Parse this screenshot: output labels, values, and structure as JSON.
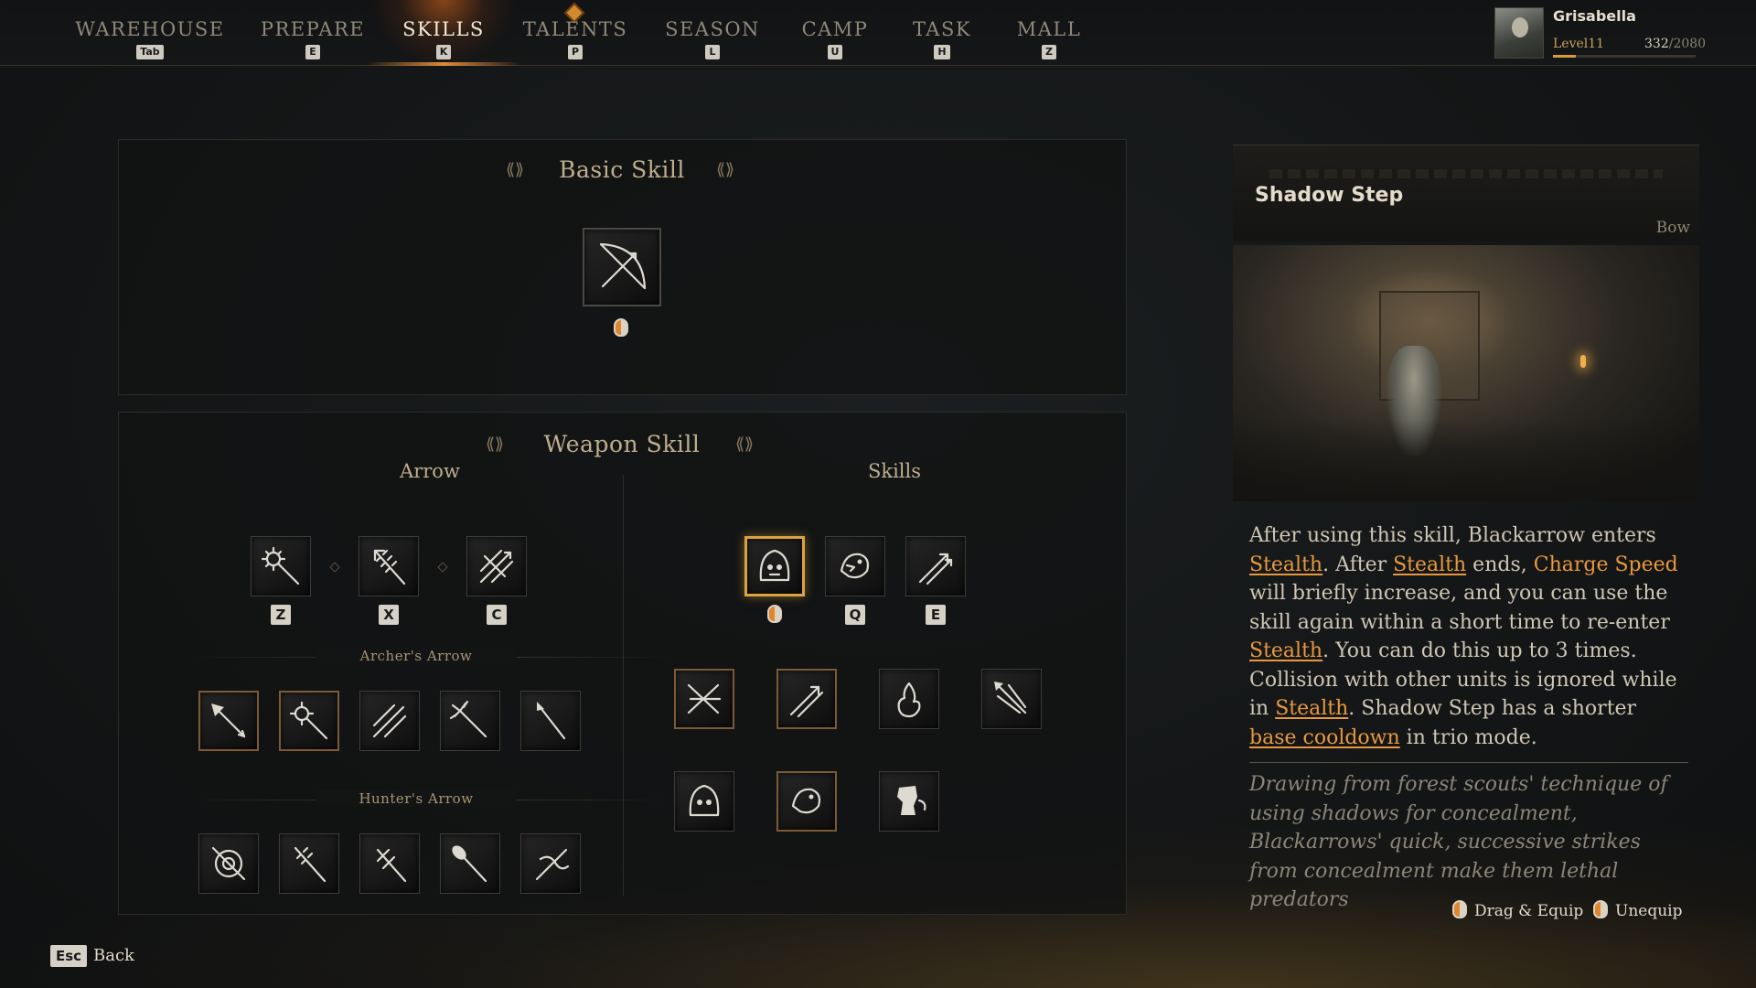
{
  "nav": {
    "items": [
      {
        "label": "WAREHOUSE",
        "key": "Tab"
      },
      {
        "label": "PREPARE",
        "key": "E"
      },
      {
        "label": "SKILLS",
        "key": "K"
      },
      {
        "label": "TALENTS",
        "key": "P"
      },
      {
        "label": "SEASON",
        "key": "L"
      },
      {
        "label": "CAMP",
        "key": "U"
      },
      {
        "label": "TASK",
        "key": "H"
      },
      {
        "label": "MALL",
        "key": "Z"
      }
    ],
    "active": "SKILLS"
  },
  "profile": {
    "name": "Grisabella",
    "level": "Level11",
    "xp_current": "332",
    "xp_max": "/2080",
    "xp_fraction": 0.16
  },
  "basic_skill": {
    "title": "Basic Skill",
    "icon": "bow-icon"
  },
  "weapon_skill": {
    "title": "Weapon Skill",
    "arrow": {
      "title": "Arrow",
      "slot_keys": [
        "Z",
        "X",
        "C"
      ],
      "archers_arrow_label": "Archer's Arrow",
      "hunters_arrow_label": "Hunter's Arrow"
    },
    "skills": {
      "title": "Skills",
      "slot_keys": [
        "Q",
        "E"
      ]
    }
  },
  "detail": {
    "title": "Shadow Step",
    "type": "Bow",
    "desc": {
      "t1": "After using this skill, Blackarrow enters ",
      "k1": "Stealth",
      "t2": ". After ",
      "k2": "Stealth",
      "t3": " ends, ",
      "k3": "Charge Speed",
      "t4": " will briefly increase, and you can use the skill again within a short time to re-enter ",
      "k4": "Stealth",
      "t5": ". You can do this up to 3 times. Collision with other units is ignored while in ",
      "k5": "Stealth",
      "t6": ". Shadow Step has a shorter ",
      "k6": "base cooldown",
      "t7": " in trio mode."
    },
    "lore": "Drawing from forest scouts' technique of using shadows for concealment, Blackarrows' quick, successive strikes from concealment make them lethal predators"
  },
  "actions": {
    "drag_equip": "Drag & Equip",
    "unequip": "Unequip"
  },
  "footer": {
    "esc_key": "Esc",
    "back_label": "Back"
  },
  "colors": {
    "accent": "#e8983e",
    "selected_border": "#d8a340",
    "key_bg": "#d6d1c7"
  }
}
